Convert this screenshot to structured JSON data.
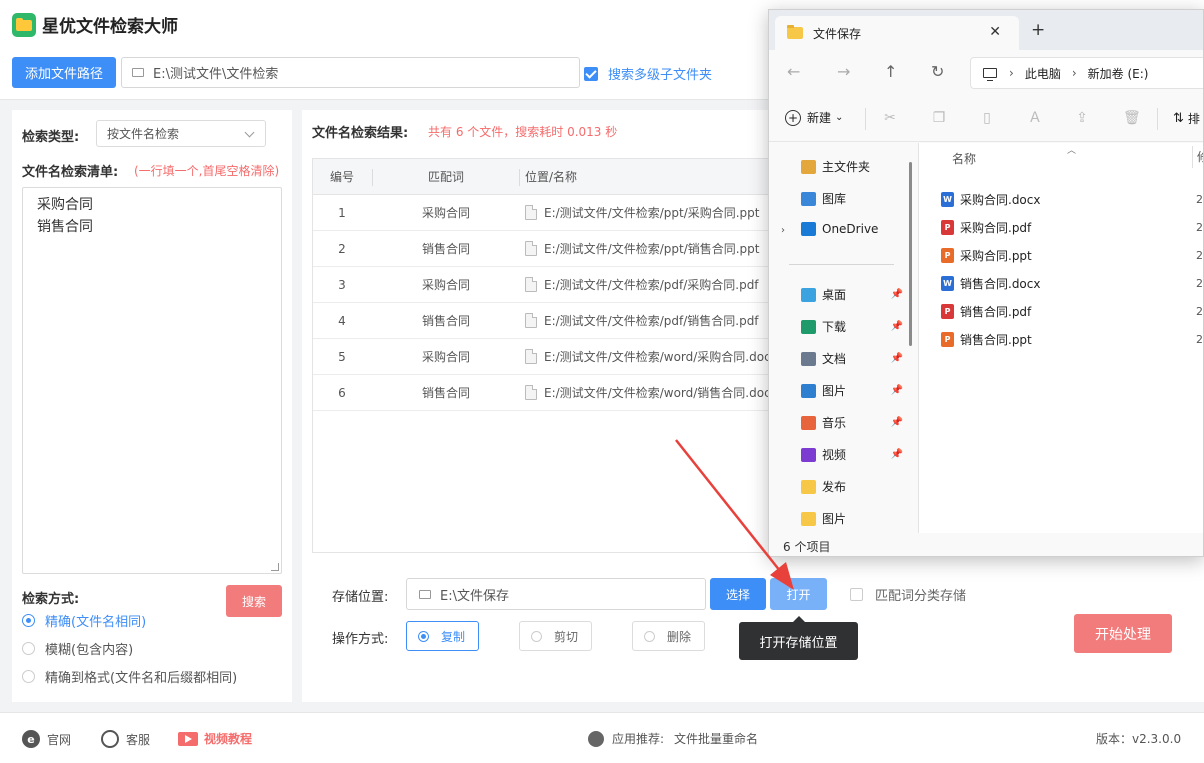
{
  "app": {
    "title": "星优文件检索大师",
    "add_path_label": "添加文件路径",
    "path_value": "E:\\测试文件\\文件检索",
    "subfolder_label": "搜索多级子文件夹"
  },
  "left": {
    "search_type_label": "检索类型:",
    "search_type_value": "按文件名检索",
    "list_label": "文件名检索清单:",
    "list_hint": "(一行填一个,首尾空格清除)",
    "list_lines": [
      "采购合同",
      "销售合同"
    ],
    "search_mode_label": "检索方式:",
    "search_button": "搜索",
    "modes": [
      {
        "label": "精确(文件名相同)",
        "selected": true
      },
      {
        "label": "模糊(包含内容)",
        "selected": false
      },
      {
        "label": "精确到格式(文件名和后缀都相同)",
        "selected": false
      }
    ]
  },
  "results": {
    "title": "文件名检索结果:",
    "stat": "共有 6 个文件，搜索耗时 0.013 秒",
    "columns": [
      "编号",
      "匹配词",
      "位置/名称"
    ],
    "rows": [
      {
        "no": "1",
        "keyword": "采购合同",
        "path": "E:/测试文件/文件检索/ppt/采购合同.ppt"
      },
      {
        "no": "2",
        "keyword": "销售合同",
        "path": "E:/测试文件/文件检索/ppt/销售合同.ppt"
      },
      {
        "no": "3",
        "keyword": "采购合同",
        "path": "E:/测试文件/文件检索/pdf/采购合同.pdf"
      },
      {
        "no": "4",
        "keyword": "销售合同",
        "path": "E:/测试文件/文件检索/pdf/销售合同.pdf"
      },
      {
        "no": "5",
        "keyword": "采购合同",
        "path": "E:/测试文件/文件检索/word/采购合同.docx"
      },
      {
        "no": "6",
        "keyword": "销售合同",
        "path": "E:/测试文件/文件检索/word/销售合同.docx"
      }
    ]
  },
  "storage": {
    "label": "存储位置:",
    "value": "E:\\文件保存",
    "select_button": "选择",
    "open_button": "打开",
    "classify_label": "匹配词分类存储",
    "op_label": "操作方式:",
    "ops": [
      {
        "label": "复制",
        "selected": true
      },
      {
        "label": "剪切",
        "selected": false
      },
      {
        "label": "删除",
        "selected": false
      }
    ],
    "start_button": "开始处理",
    "tooltip": "打开存储位置"
  },
  "footer": {
    "website": "官网",
    "website_icon": "e",
    "service": "客服",
    "video": "视频教程",
    "recommend_label": "应用推荐:",
    "recommend_app": "文件批量重命名",
    "version": "版本：v2.3.0.0"
  },
  "explorer": {
    "tab_title": "文件保存",
    "close_glyph": "✕",
    "new_tab_glyph": "+",
    "nav": {
      "back": "←",
      "forward": "→",
      "up": "↑",
      "refresh": "↻"
    },
    "breadcrumb": [
      "此电脑",
      "新加卷 (E:)"
    ],
    "toolbar": {
      "new_label": "新建",
      "new_caret": "⌄",
      "sort_label": "排"
    },
    "sidebar": [
      {
        "label": "主文件夹",
        "icon": "home-icon",
        "color": "#e3a73c",
        "pinned": false
      },
      {
        "label": "图库",
        "icon": "gallery-icon",
        "color": "#3a86d9",
        "pinned": false
      },
      {
        "label": "OneDrive",
        "icon": "cloud-icon",
        "color": "#1a7bd6",
        "pinned": false
      },
      {
        "label": "桌面",
        "icon": "desktop-icon",
        "color": "#3aa3e0",
        "pinned": true
      },
      {
        "label": "下载",
        "icon": "download-icon",
        "color": "#1f9a6a",
        "pinned": true
      },
      {
        "label": "文档",
        "icon": "document-icon",
        "color": "#6b7a8f",
        "pinned": true
      },
      {
        "label": "图片",
        "icon": "picture-icon",
        "color": "#2f7fd1",
        "pinned": true
      },
      {
        "label": "音乐",
        "icon": "music-icon",
        "color": "#e8643c",
        "pinned": true
      },
      {
        "label": "视频",
        "icon": "video-icon",
        "color": "#7c3cd1",
        "pinned": true
      },
      {
        "label": "发布",
        "icon": "folder-icon",
        "color": "#f7c848",
        "pinned": false
      },
      {
        "label": "图片",
        "icon": "folder-icon",
        "color": "#f7c848",
        "pinned": false
      }
    ],
    "pin_glyph": "📌",
    "column_name": "名称",
    "column_next": "修",
    "files": [
      {
        "name": "采购合同.docx",
        "type": "docx",
        "badge": "W",
        "date": "2"
      },
      {
        "name": "采购合同.pdf",
        "type": "pdf",
        "badge": "P",
        "date": "2"
      },
      {
        "name": "采购合同.ppt",
        "type": "ppt",
        "badge": "P",
        "date": "2"
      },
      {
        "name": "销售合同.docx",
        "type": "docx",
        "badge": "W",
        "date": "2"
      },
      {
        "name": "销售合同.pdf",
        "type": "pdf",
        "badge": "P",
        "date": "2"
      },
      {
        "name": "销售合同.ppt",
        "type": "ppt",
        "badge": "P",
        "date": "2"
      }
    ],
    "status": "6 个项目"
  },
  "colors": {
    "primary": "#3e8ef7",
    "danger": "#f27c7c",
    "annotation_arrow": "#e8413c"
  }
}
